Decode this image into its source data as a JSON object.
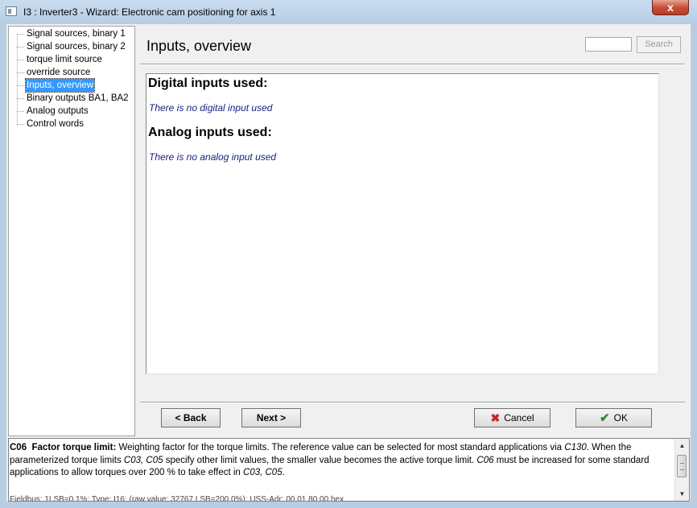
{
  "window": {
    "title": "I3 : Inverter3 - Wizard: Electronic cam positioning for axis 1",
    "close_glyph": "x"
  },
  "tree": {
    "items": [
      {
        "label": "Signal sources, binary 1",
        "selected": false
      },
      {
        "label": "Signal sources, binary 2",
        "selected": false
      },
      {
        "label": "torque limit source",
        "selected": false
      },
      {
        "label": "override source",
        "selected": false
      },
      {
        "label": "Inputs, overview",
        "selected": true
      },
      {
        "label": "Binary outputs BA1, BA2",
        "selected": false
      },
      {
        "label": "Analog outputs",
        "selected": false
      },
      {
        "label": "Control words",
        "selected": false
      }
    ]
  },
  "panel": {
    "title": "Inputs, overview",
    "search_value": "",
    "search_label": "Search"
  },
  "content": {
    "digital_heading": "Digital inputs used:",
    "digital_text": "There is no digital input used",
    "analog_heading": "Analog inputs used:",
    "analog_text": "There is no analog input used"
  },
  "buttons": {
    "back": "< Back",
    "next": "Next >",
    "cancel": "Cancel",
    "ok": "OK"
  },
  "help": {
    "code": "C06",
    "heading": "Factor torque limit:",
    "p1": " Weighting factor for the torque limits. The reference value can be selected for most standard applications via ",
    "ref1": "C130",
    "p2": ". When the parameterized torque limits ",
    "ref2": "C03, C05",
    "p3": " specify other limit values, the smaller value becomes the active torque limit. ",
    "ref3": "C06",
    "p4": " must be increased for some standard applications to allow torques over 200 % to take effect in ",
    "ref4": "C03, C05",
    "p5": ".",
    "footer": "Fieldbus: 1LSB=0.1%; Type: I16; (raw value: 32767 LSB=200.0%); USS-Adr: 00 01 80 00 hex"
  },
  "colors": {
    "selection": "#3399ff",
    "info_text": "#1a237e",
    "cancel_icon": "#c62828",
    "ok_icon": "#2e8b2e"
  }
}
